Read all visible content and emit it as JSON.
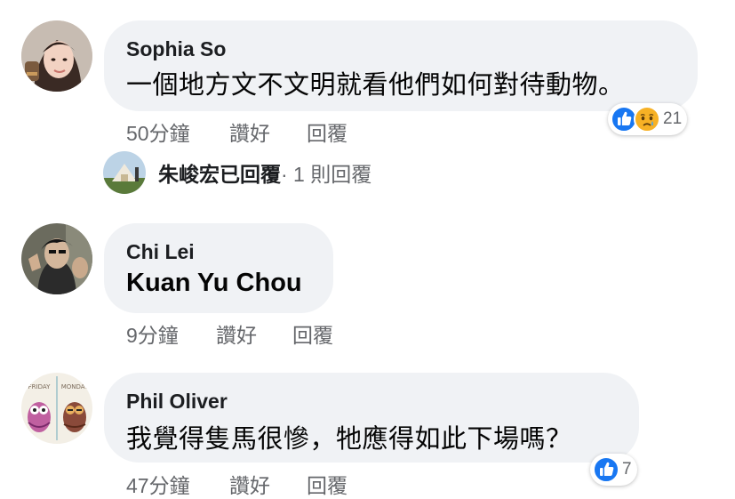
{
  "comments": [
    {
      "author": "Sophia So",
      "text": "一個地方文不文明就看他們如何對待動物。",
      "time": "50分鐘",
      "like_label": "讚好",
      "reply_label": "回覆",
      "reactions": [
        "like",
        "sad"
      ],
      "reaction_count": "21",
      "replies": {
        "author": "朱峻宏",
        "suffix": "已回覆",
        "count_text": " · 1 則回覆"
      }
    },
    {
      "author": "Chi Lei",
      "text": "Kuan Yu Chou",
      "time": "9分鐘",
      "like_label": "讚好",
      "reply_label": "回覆"
    },
    {
      "author": "Phil Oliver",
      "text": "我覺得隻馬很慘，牠應得如此下場嗎？",
      "time": "47分鐘",
      "like_label": "讚好",
      "reply_label": "回覆",
      "reactions": [
        "like"
      ],
      "reaction_count": "7",
      "avatar_labels": [
        "FRIDAY",
        "MONDAY"
      ]
    }
  ],
  "colors": {
    "bubble": "#f0f2f5",
    "meta": "#65676b",
    "like_blue": "#1877f2",
    "sad_yellow": "#f7b125"
  }
}
